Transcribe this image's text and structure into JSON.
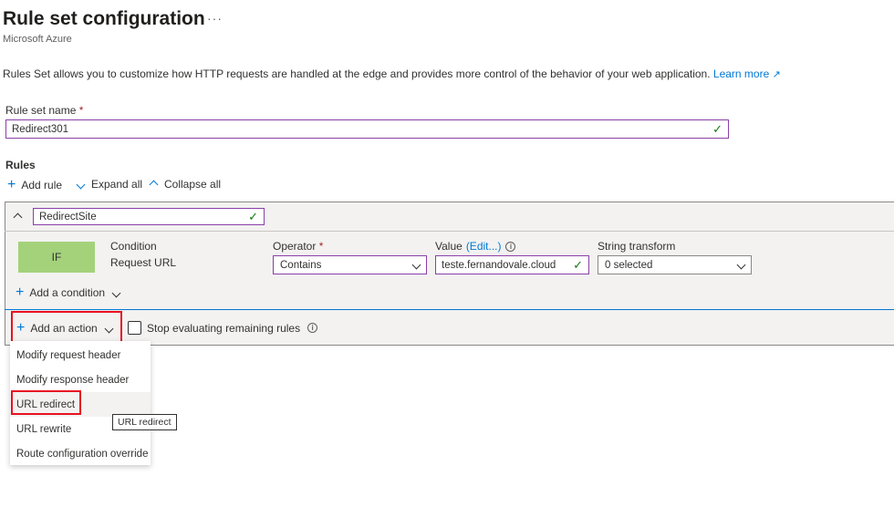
{
  "header": {
    "title": "Rule set configuration",
    "more_label": "···",
    "subtitle": "Microsoft Azure"
  },
  "description": {
    "text": "Rules Set allows you to customize how HTTP requests are handled at the edge and provides more control of the behavior of your web application.",
    "learn_more": "Learn more",
    "learn_more_icon": "external-link-icon"
  },
  "ruleset_name": {
    "label": "Rule set name",
    "required_mark": "*",
    "value": "Redirect301"
  },
  "rules": {
    "heading": "Rules",
    "toolbar": {
      "add_rule": "Add rule",
      "expand_all": "Expand all",
      "collapse_all": "Collapse all"
    },
    "rule": {
      "name": "RedirectSite",
      "if_label": "IF",
      "condition_header": "Condition",
      "condition_value": "Request URL",
      "operator_label": "Operator",
      "operator_required": "*",
      "operator_value": "Contains",
      "value_label": "Value",
      "value_edit": "(Edit...)",
      "value_value": "teste.fernandovale.cloud",
      "transform_label": "String transform",
      "transform_value": "0 selected",
      "add_condition": "Add a condition",
      "add_action": "Add an action",
      "stop_evaluating": "Stop evaluating remaining rules"
    }
  },
  "action_menu": {
    "items": [
      "Modify request header",
      "Modify response header",
      "URL redirect",
      "URL rewrite",
      "Route configuration override"
    ],
    "hovered_index": 2,
    "tooltip": "URL redirect"
  },
  "colors": {
    "accent": "#0078d4",
    "valid_border": "#8a3fa8",
    "success": "#107c10",
    "if_badge": "#a3d27b",
    "highlight_box": "#e81123"
  }
}
